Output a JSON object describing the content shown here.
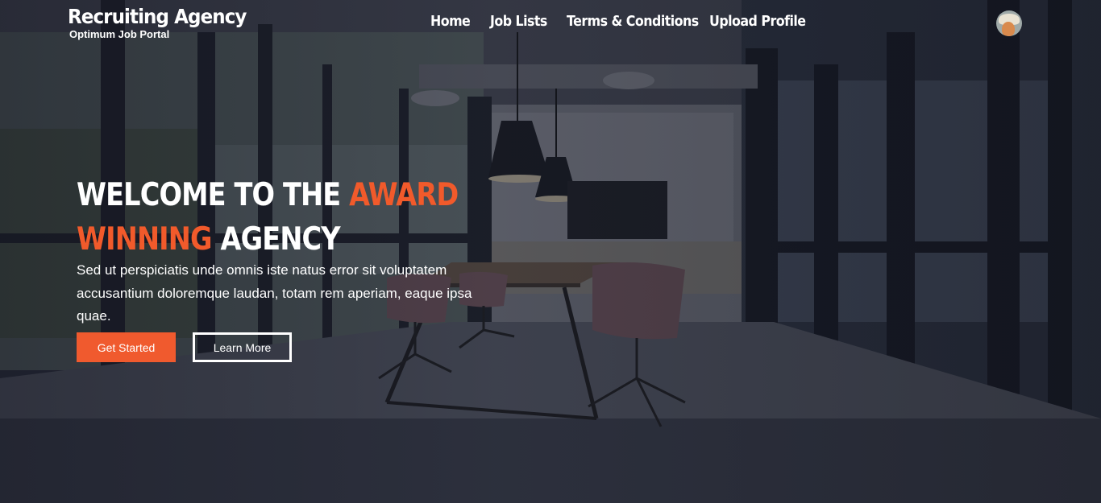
{
  "brand": {
    "title": "Recruiting Agency",
    "subtitle": "Optimum Job Portal"
  },
  "nav": {
    "items": [
      {
        "label": "Home"
      },
      {
        "label": "Job Lists"
      },
      {
        "label": "Terms & Conditions"
      },
      {
        "label": "Upload Profile"
      }
    ]
  },
  "hero": {
    "title_part1": "WELCOME TO THE ",
    "title_accent1": "AWARD WINNING",
    "title_part2": " AGENCY",
    "description": "Sed ut perspiciatis unde omnis iste natus error sit voluptatem accusantium doloremque laudan, totam rem aperiam, eaque ipsa quae.",
    "primary_button": "Get Started",
    "secondary_button": "Learn More"
  },
  "colors": {
    "accent": "#f15a2b",
    "text": "#ffffff",
    "overlay": "#1e2130"
  },
  "icons": {
    "avatar": "user-avatar-icon"
  }
}
